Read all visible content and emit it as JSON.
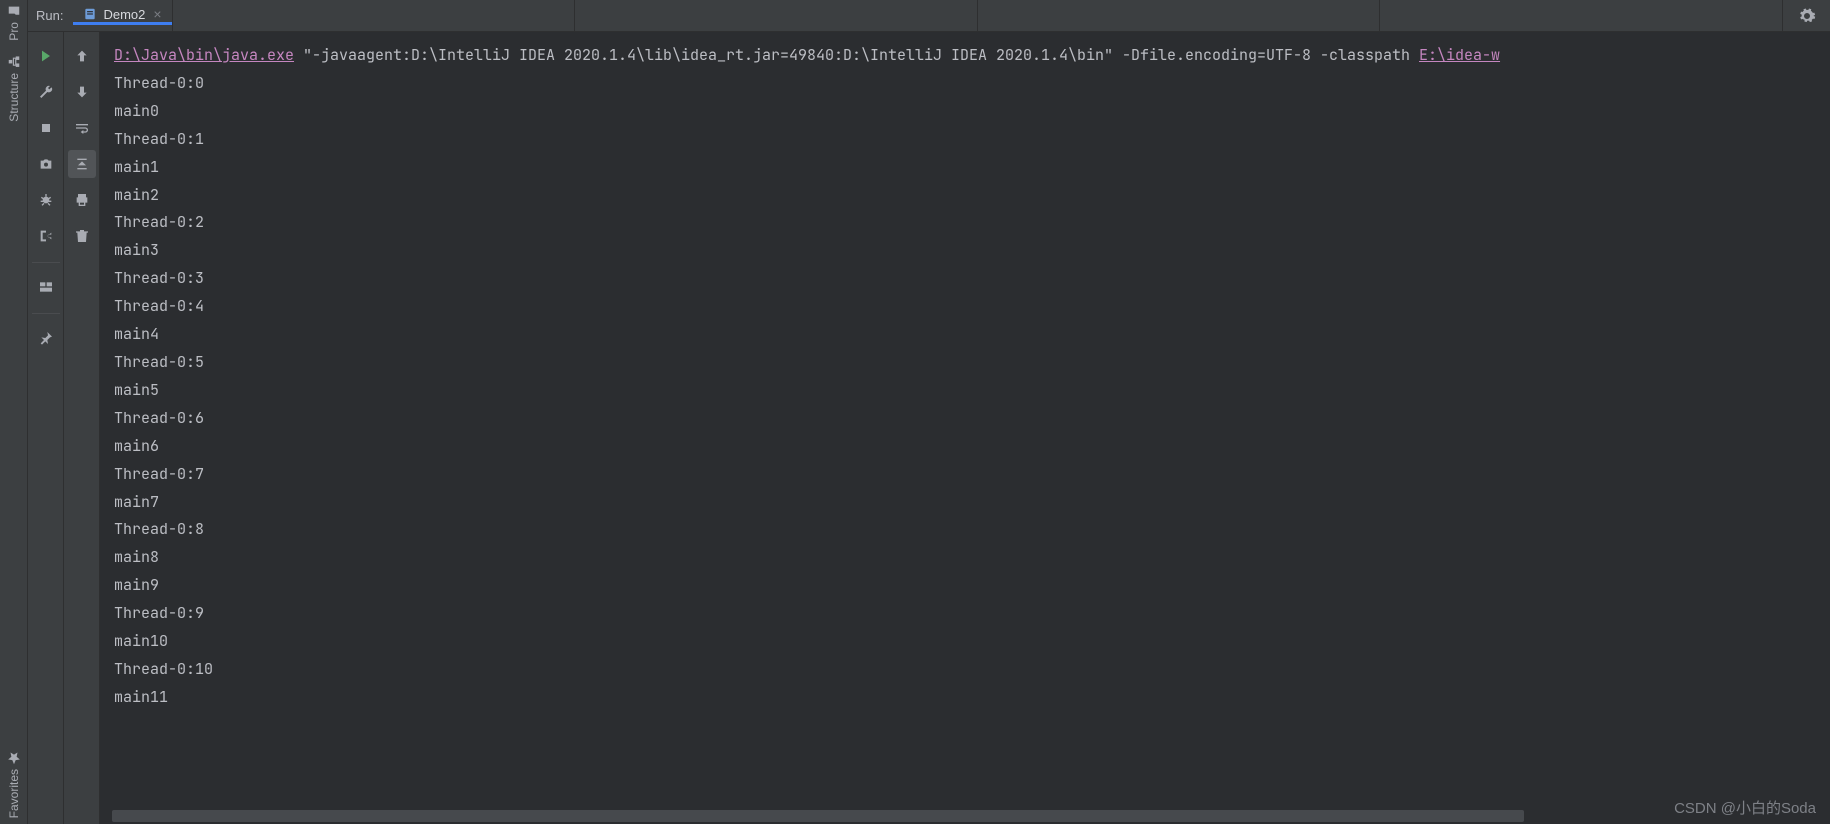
{
  "tool_windows": {
    "top": [
      {
        "id": "project",
        "label": "Pro",
        "icon": "folder"
      },
      {
        "id": "structure",
        "label": "Structure",
        "icon": "structure"
      }
    ],
    "bottom": [
      {
        "id": "favorites",
        "label": "Favorites",
        "icon": "star"
      }
    ]
  },
  "header": {
    "run_label": "Run:",
    "tab": {
      "name": "Demo2",
      "icon": "class-file"
    },
    "settings_icon": "gear"
  },
  "run_toolbar_col1": [
    {
      "id": "rerun",
      "icon": "play",
      "green": true
    },
    {
      "id": "wrench",
      "icon": "wrench"
    },
    {
      "id": "stop",
      "icon": "stop"
    },
    {
      "id": "snapshot",
      "icon": "camera"
    },
    {
      "id": "debug-bug",
      "icon": "bug"
    },
    {
      "id": "exit",
      "icon": "exit"
    },
    {
      "id": "sep",
      "icon": "sep"
    },
    {
      "id": "layout",
      "icon": "layout"
    },
    {
      "id": "sep2",
      "icon": "sep"
    },
    {
      "id": "pin",
      "icon": "pin"
    }
  ],
  "run_toolbar_col2": [
    {
      "id": "up",
      "icon": "arrow-up"
    },
    {
      "id": "down",
      "icon": "arrow-down"
    },
    {
      "id": "soft-wrap",
      "icon": "wrap"
    },
    {
      "id": "scroll-end",
      "icon": "scroll-end",
      "selected": true
    },
    {
      "id": "print",
      "icon": "print"
    },
    {
      "id": "trash",
      "icon": "trash"
    }
  ],
  "console": {
    "cmd": {
      "link1": "D:\\Java\\bin\\java.exe",
      "middle": " \"-javaagent:D:\\IntelliJ IDEA 2020.1.4\\lib\\idea_rt.jar=49840:D:\\IntelliJ IDEA 2020.1.4\\bin\" -Dfile.encoding=UTF-8 -classpath ",
      "link2": "E:\\idea-w"
    },
    "lines": [
      "Thread-0:0",
      "main0",
      "Thread-0:1",
      "main1",
      "main2",
      "Thread-0:2",
      "main3",
      "Thread-0:3",
      "Thread-0:4",
      "main4",
      "Thread-0:5",
      "main5",
      "Thread-0:6",
      "main6",
      "Thread-0:7",
      "main7",
      "Thread-0:8",
      "main8",
      "main9",
      "Thread-0:9",
      "main10",
      "Thread-0:10",
      "main11"
    ]
  },
  "watermark": "CSDN @小白的Soda"
}
